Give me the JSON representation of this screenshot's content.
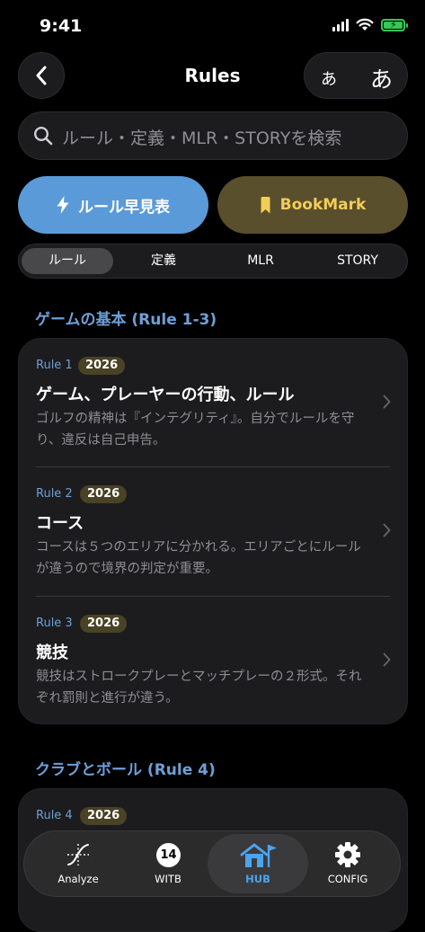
{
  "status_bar": {
    "time": "9:41"
  },
  "header": {
    "title": "Rules",
    "font_small": "あ",
    "font_large": "あ"
  },
  "search": {
    "placeholder": "ルール・定義・MLR・STORYを検索"
  },
  "actions": {
    "quick_label": "ルール早見表",
    "bookmark_label": "BookMark"
  },
  "segments": [
    {
      "label": "ルール",
      "active": true
    },
    {
      "label": "定義",
      "active": false
    },
    {
      "label": "MLR",
      "active": false
    },
    {
      "label": "STORY",
      "active": false
    }
  ],
  "sections": [
    {
      "title": "ゲームの基本 (Rule 1-3)",
      "rules": [
        {
          "number": "Rule 1",
          "badge": "2026",
          "title": "ゲーム、プレーヤーの行動、ルール",
          "desc": "ゴルフの精神は『インテグリティ』。自分でルールを守り、違反は自己申告。"
        },
        {
          "number": "Rule 2",
          "badge": "2026",
          "title": "コース",
          "desc": "コースは５つのエリアに分かれる。エリアごとにルールが違うので境界の判定が重要。"
        },
        {
          "number": "Rule 3",
          "badge": "2026",
          "title": "競技",
          "desc": "競技はストロークプレーとマッチプレーの２形式。それぞれ罰則と進行が違う。"
        }
      ]
    },
    {
      "title": "クラブとボール (Rule 4)",
      "rules": [
        {
          "number": "Rule 4",
          "badge": "2026"
        }
      ]
    }
  ],
  "tabbar": {
    "items": [
      {
        "label": "Analyze",
        "icon": "analyze-icon"
      },
      {
        "label": "WITB",
        "icon": "witb-icon",
        "count": "14"
      },
      {
        "label": "HUB",
        "icon": "hub-icon",
        "active": true
      },
      {
        "label": "CONFIG",
        "icon": "gear-icon"
      }
    ]
  },
  "colors": {
    "accent_blue": "#5b9ad8",
    "section_blue": "#6e9fd8",
    "bookmark_gold": "#f2cd58",
    "active_tab": "#4aa4f0"
  }
}
